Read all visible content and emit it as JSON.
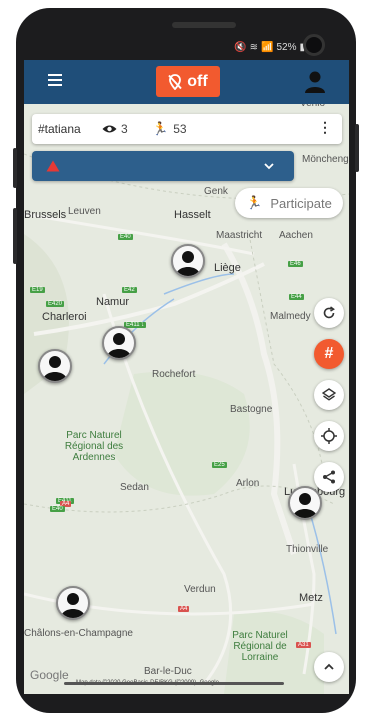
{
  "status": {
    "signal": "📶",
    "battery_text": "52%"
  },
  "toolbar": {
    "off_label": "off"
  },
  "infobar": {
    "tag": "#tatiana",
    "views": "3",
    "runners": "53"
  },
  "participate": {
    "label": "Participate"
  },
  "fabs": {
    "hash_label": "#"
  },
  "map": {
    "labels": [
      {
        "text": "Brussels",
        "class": "city"
      },
      {
        "text": "Leuven",
        "class": ""
      },
      {
        "text": "Genk",
        "class": ""
      },
      {
        "text": "Hasselt",
        "class": "city"
      },
      {
        "text": "Maastricht",
        "class": ""
      },
      {
        "text": "Aachen",
        "class": ""
      },
      {
        "text": "Liège",
        "class": "city"
      },
      {
        "text": "Namur",
        "class": "city"
      },
      {
        "text": "Charleroi",
        "class": "city"
      },
      {
        "text": "Rochefort",
        "class": ""
      },
      {
        "text": "Bastogne",
        "class": ""
      },
      {
        "text": "Malmedy",
        "class": ""
      },
      {
        "text": "Sedan",
        "class": ""
      },
      {
        "text": "Arlon",
        "class": ""
      },
      {
        "text": "Luxembourg",
        "class": "city"
      },
      {
        "text": "Thionville",
        "class": ""
      },
      {
        "text": "Verdun",
        "class": ""
      },
      {
        "text": "Metz",
        "class": "city"
      },
      {
        "text": "Châlons-en-Champagne",
        "class": ""
      },
      {
        "text": "Bar-le-Duc",
        "class": ""
      },
      {
        "text": "Mönchengladbach",
        "class": ""
      },
      {
        "text": "Venlo",
        "class": ""
      }
    ],
    "parks": [
      {
        "text": "Parc Naturel Régional des Ardennes"
      },
      {
        "text": "Parc Naturel Régional de Lorraine"
      }
    ],
    "shields": [
      "E40",
      "E42",
      "E19",
      "E420",
      "E411",
      "E25",
      "E411",
      "E46",
      "E44",
      "A4",
      "A4",
      "A31",
      "E411",
      "E40"
    ],
    "google": "Google",
    "attribution": "Map data ©2020 GeoBasis-DE/BKG (©2009), Google"
  },
  "colors": {
    "appbar": "#1f4e79",
    "accent": "#f25a2f",
    "alert": "#2d5f8c"
  }
}
